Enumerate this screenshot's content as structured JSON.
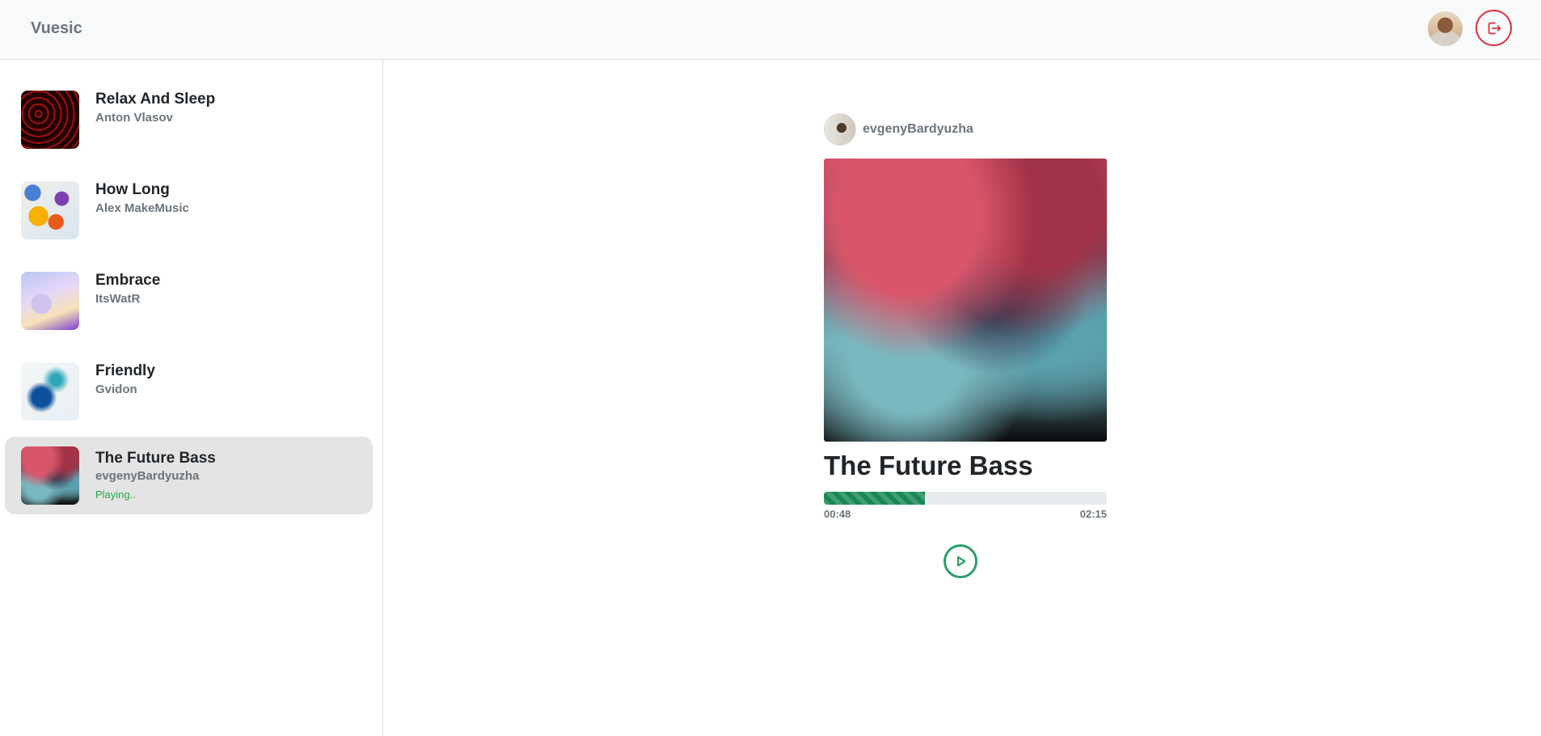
{
  "header": {
    "brand": "Vuesic",
    "avatar_icon": "user-avatar",
    "logout_icon": "logout-icon",
    "accent_color": "#dc3545"
  },
  "sidebar": {
    "tracks": [
      {
        "title": "Relax And Sleep",
        "artist": "Anton Vlasov",
        "status": ""
      },
      {
        "title": "How Long",
        "artist": "Alex MakeMusic",
        "status": ""
      },
      {
        "title": "Embrace",
        "artist": "ItsWatR",
        "status": ""
      },
      {
        "title": "Friendly",
        "artist": "Gvidon",
        "status": ""
      },
      {
        "title": "The Future Bass",
        "artist": "evgenyBardyuzha",
        "status": "Playing.."
      }
    ],
    "active_index": 4
  },
  "player": {
    "uploader": "evgenyBardyuzha",
    "title": "The Future Bass",
    "current_time": "00:48",
    "total_time": "02:15",
    "progress_fraction": 0.356,
    "progress_color": "#198754",
    "play_icon": "play-circle-icon"
  }
}
